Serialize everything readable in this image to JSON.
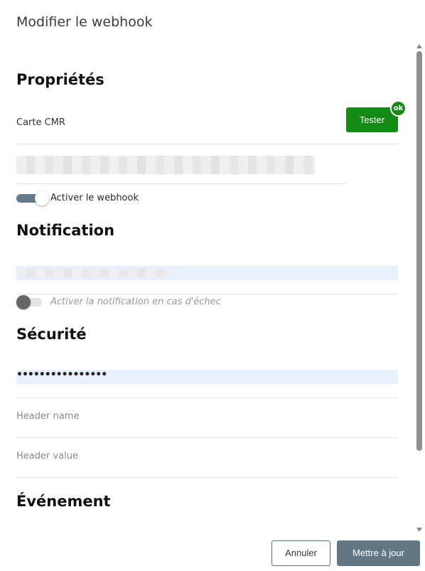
{
  "dialog": {
    "title": "Modifier le webhook"
  },
  "sections": {
    "properties": {
      "title": "Propriétés",
      "name_value": "Carte CMR",
      "test_button": "Tester",
      "test_status": "ok",
      "enable_toggle": {
        "label": "Activer le webhook",
        "checked": true
      }
    },
    "notification": {
      "title": "Notification",
      "failure_toggle": {
        "label": "Activer la notification en cas d'échec",
        "checked": false
      }
    },
    "security": {
      "title": "Sécurité",
      "password_value": "••••••••••••••••",
      "header_name_placeholder": "Header name",
      "header_value_placeholder": "Header value"
    },
    "event": {
      "title": "Événement"
    }
  },
  "footer": {
    "cancel_label": "Annuler",
    "update_label": "Mettre à jour"
  },
  "colors": {
    "test_button": "#138a14",
    "primary": "#627784",
    "toggle_on": "#637a8a",
    "autofill": "#e8f0fe"
  }
}
